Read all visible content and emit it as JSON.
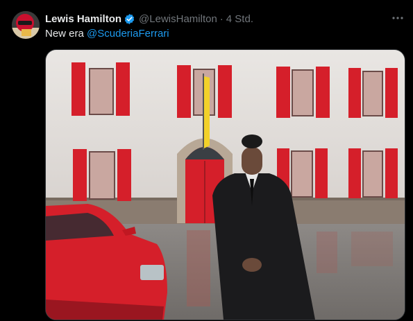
{
  "author": {
    "name": "Lewis Hamilton",
    "handle": "@LewisHamilton",
    "separator": "·",
    "time": "4 Std.",
    "verified_icon": "verified-badge-icon",
    "verified_color": "#1d9bf0"
  },
  "tweet": {
    "text_prefix": "New era ",
    "mention": "@ScuderiaFerrari"
  },
  "colors": {
    "background": "#000000",
    "text": "#e7e9ea",
    "muted": "#71767b",
    "link": "#1d9bf0",
    "ferrari_red": "#d51f2a"
  },
  "icons": [
    "more-options-icon",
    "verified-badge-icon"
  ]
}
